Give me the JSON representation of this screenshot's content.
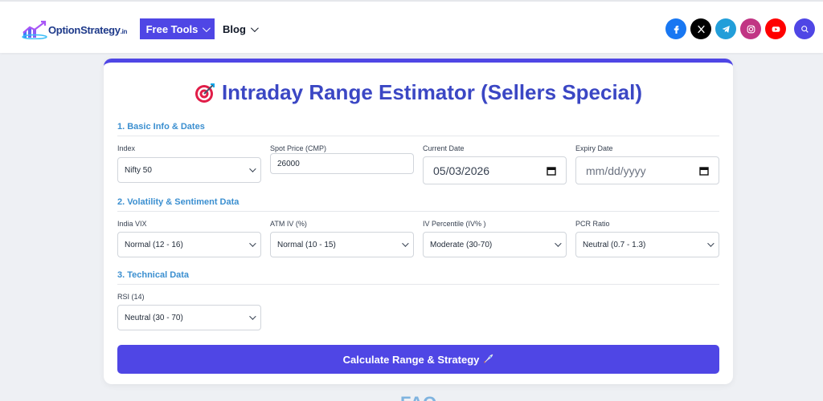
{
  "header": {
    "logo_text": "OptionStrategy",
    "logo_suffix": ".in",
    "nav": {
      "free_tools": "Free Tools",
      "blog": "Blog"
    },
    "social": [
      {
        "name": "facebook-icon",
        "color": "#1877f2"
      },
      {
        "name": "x-icon",
        "color": "#000000"
      },
      {
        "name": "telegram-icon",
        "color": "#229ed9"
      },
      {
        "name": "instagram-icon",
        "color": "#c13584"
      },
      {
        "name": "youtube-icon",
        "color": "#ff0000"
      },
      {
        "name": "search-icon",
        "color": "#4f46e5"
      }
    ]
  },
  "card": {
    "title": "Intraday Range Estimator (Sellers Special)",
    "title_icon": "target-icon",
    "section1": "1. Basic Info & Dates",
    "section2": "2. Volatility & Sentiment Data",
    "section3": "3. Technical Data",
    "fields": {
      "index": {
        "label": "Index",
        "value": "Nifty 50"
      },
      "spot": {
        "label": "Spot Price (CMP)",
        "value": "26000"
      },
      "current_date": {
        "label": "Current Date",
        "value": "05/03/2026"
      },
      "expiry_date": {
        "label": "Expiry Date",
        "placeholder": "mm/dd/yyyy"
      },
      "vix": {
        "label": "India VIX",
        "value": "Normal (12 - 16)"
      },
      "atm_iv": {
        "label": "ATM IV (%)",
        "value": "Normal (10 - 15)"
      },
      "iv_percentile": {
        "label": "IV Percentile (IV% )",
        "value": "Moderate (30-70)"
      },
      "pcr": {
        "label": "PCR Ratio",
        "value": "Neutral (0.7 - 1.3)"
      },
      "rsi": {
        "label": "RSI (14)",
        "value": "Neutral (30 - 70)"
      }
    },
    "button": "Calculate Range & Strategy",
    "button_icon": "rocket-icon"
  },
  "faq_heading": "FAQ",
  "colors": {
    "accent": "#4f46e5",
    "section": "#3b8fd0",
    "title": "#3b47c4"
  }
}
